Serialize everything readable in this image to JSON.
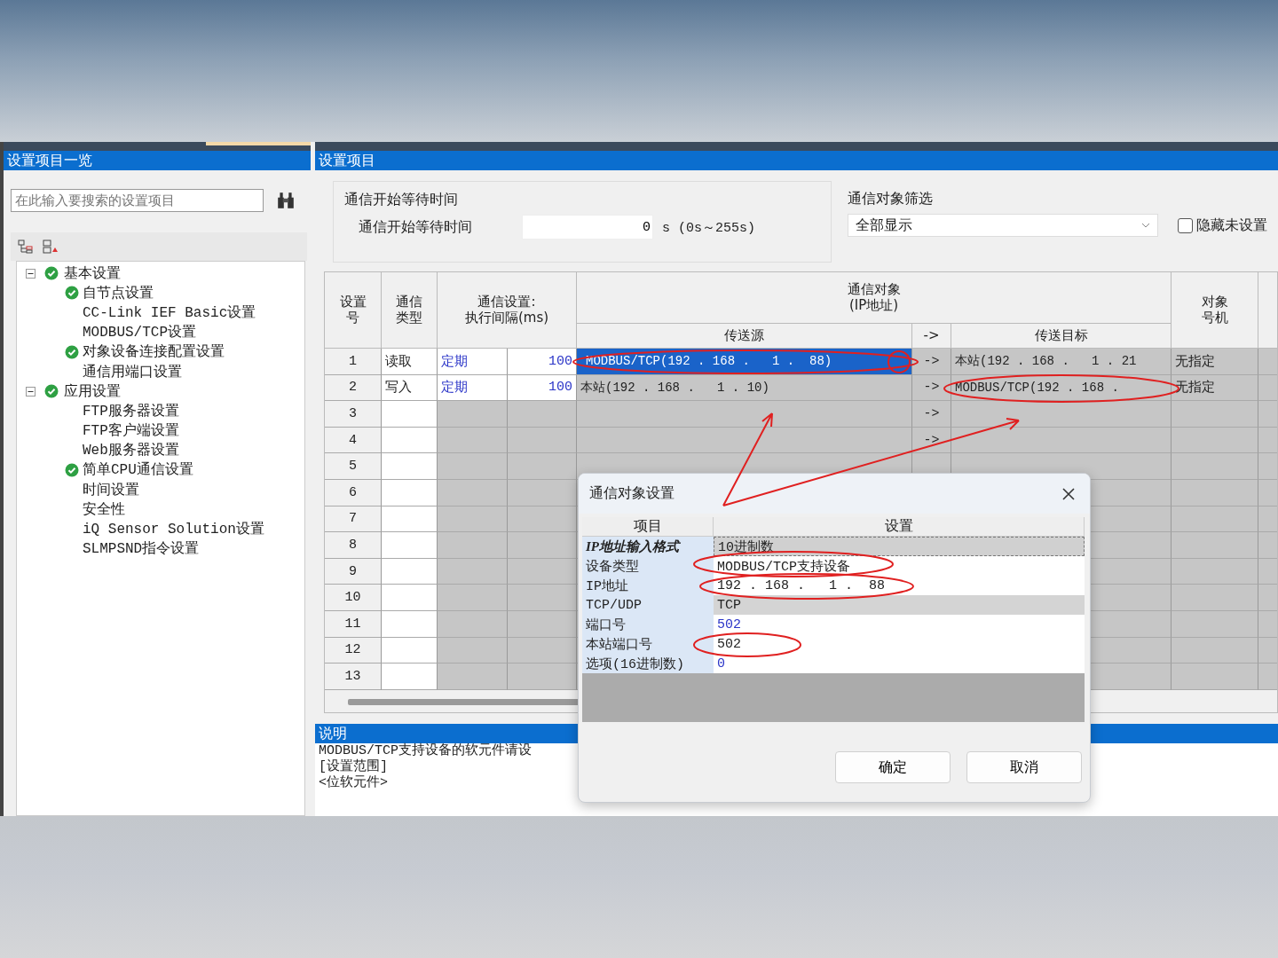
{
  "left_panel": {
    "title": "设置项目一览",
    "search": {
      "placeholder": "在此输入要搜索的设置项目"
    },
    "tree": [
      {
        "label": "基本设置",
        "done": true,
        "expanded": true,
        "children": [
          {
            "label": "自节点设置",
            "done": true
          },
          {
            "label": "CC-Link IEF Basic设置",
            "done": false
          },
          {
            "label": "MODBUS/TCP设置",
            "done": false
          },
          {
            "label": "对象设备连接配置设置",
            "done": true
          },
          {
            "label": "通信用端口设置",
            "done": false
          }
        ]
      },
      {
        "label": "应用设置",
        "done": true,
        "expanded": true,
        "children": [
          {
            "label": "FTP服务器设置",
            "done": false
          },
          {
            "label": "FTP客户端设置",
            "done": false
          },
          {
            "label": "Web服务器设置",
            "done": false
          },
          {
            "label": "简单CPU通信设置",
            "done": true
          },
          {
            "label": "时间设置",
            "done": false
          },
          {
            "label": "安全性",
            "done": false
          },
          {
            "label": "iQ Sensor Solution设置",
            "done": false
          },
          {
            "label": "SLMPSND指令设置",
            "done": false
          }
        ]
      }
    ]
  },
  "right_panel": {
    "title": "设置项目",
    "wait_group": {
      "title": "通信开始等待时间",
      "label": "通信开始等待时间",
      "value": "0",
      "unit": "s (0s～255s)"
    },
    "filter_group": {
      "title": "通信对象筛选",
      "dropdown": {
        "value": "全部显示"
      },
      "hide_checkbox": {
        "label": "隐藏未设置",
        "checked": false
      }
    },
    "table": {
      "header": {
        "no": "设置号",
        "type": "通信类型",
        "setting": "通信设置:\n执行间隔(ms)",
        "target": "通信对象\n(IP地址)",
        "source": "传送源",
        "arrow": "->",
        "dest": "传送目标",
        "station": "对象号机"
      },
      "rows": [
        {
          "no": "1",
          "type": "读取",
          "mode": "定期",
          "interval": "100",
          "source": "MODBUS/TCP(192 . 168 .   1 .  88)",
          "arrow": "->",
          "target": "本站(192 . 168 .   1 . 21",
          "station": "无指定",
          "selected": true
        },
        {
          "no": "2",
          "type": "写入",
          "mode": "定期",
          "interval": "100",
          "source": "本站(192 . 168 .   1 . 10)",
          "arrow": "->",
          "target": "MODBUS/TCP(192 . 168 .",
          "station": "无指定",
          "selected": false
        },
        {
          "no": "3",
          "arrow": "->",
          "selected": false
        },
        {
          "no": "4",
          "arrow": "->",
          "selected": false
        },
        {
          "no": "5",
          "selected": false
        },
        {
          "no": "6",
          "selected": false
        },
        {
          "no": "7",
          "selected": false
        },
        {
          "no": "8",
          "selected": false
        },
        {
          "no": "9",
          "selected": false
        },
        {
          "no": "10",
          "selected": false
        },
        {
          "no": "11",
          "selected": false
        },
        {
          "no": "12",
          "selected": false
        },
        {
          "no": "13",
          "selected": false
        }
      ]
    },
    "description": {
      "title": "说明",
      "lines": [
        "MODBUS/TCP支持设备的软元件请设",
        "[设置范围]",
        "<位软元件>"
      ]
    }
  },
  "dialog": {
    "title": "通信对象设置",
    "columns": [
      "项目",
      "设置"
    ],
    "rows": [
      {
        "item": "IP地址输入格式",
        "value": "10进制数",
        "kind": "format"
      },
      {
        "item": "设备类型",
        "value": "MODBUS/TCP支持设备",
        "kind": "text"
      },
      {
        "item": "IP地址",
        "value": "192 . 168 .   1 .  88",
        "kind": "text"
      },
      {
        "item": "TCP/UDP",
        "value": "TCP",
        "kind": "fixed"
      },
      {
        "item": "端口号",
        "value": "502",
        "kind": "number"
      },
      {
        "item": "本站端口号",
        "value": "502",
        "kind": "text"
      },
      {
        "item": "选项(16进制数)",
        "value": "0",
        "kind": "number"
      }
    ],
    "buttons": [
      "确定",
      "取消"
    ]
  }
}
